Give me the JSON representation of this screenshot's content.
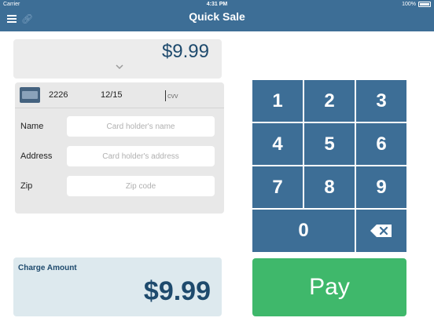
{
  "status_bar": {
    "carrier": "Carrier",
    "time": "4:31 PM",
    "battery": "100%"
  },
  "header": {
    "title": "Quick Sale"
  },
  "amount_display": {
    "value": "$9.99"
  },
  "card": {
    "last4": "2226",
    "expiry": "12/15",
    "cvv_placeholder": "cvv"
  },
  "form": {
    "name_label": "Name",
    "name_placeholder": "Card holder's name",
    "address_label": "Address",
    "address_placeholder": "Card holder's address",
    "zip_label": "Zip",
    "zip_placeholder": "Zip code"
  },
  "charge": {
    "label": "Charge Amount",
    "amount": "$9.99"
  },
  "keypad": {
    "k1": "1",
    "k2": "2",
    "k3": "3",
    "k4": "4",
    "k5": "5",
    "k6": "6",
    "k7": "7",
    "k8": "8",
    "k9": "9",
    "k0": "0"
  },
  "pay_label": "Pay",
  "icons": {
    "menu": "menu-icon",
    "link": "link-icon",
    "chevron": "chevron-down-icon",
    "card": "credit-card-icon",
    "backspace": "backspace-icon"
  },
  "colors": {
    "header": "#3d6e96",
    "keypad": "#3d6e96",
    "pay": "#3fb86b",
    "charge_panel": "#dde9ee",
    "amount_text": "#1e4a6d"
  }
}
